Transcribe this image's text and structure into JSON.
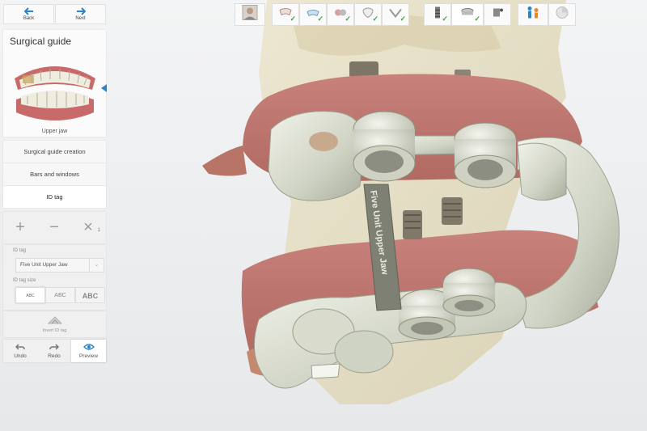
{
  "nav": {
    "back_label": "Back",
    "next_label": "Next"
  },
  "panel": {
    "title": "Surgical guide",
    "jaw_label": "Upper jaw",
    "steps": [
      {
        "label": "Surgical guide creation"
      },
      {
        "label": "Bars and windows"
      },
      {
        "label": "ID tag"
      }
    ],
    "tool_count": "1",
    "id_tag_label": "ID tag",
    "id_tag_value": "Five Unit Upper Jaw",
    "id_tag_size_label": "ID tag size",
    "sizes": [
      "ABC",
      "ABC",
      "ABC"
    ],
    "invert_label": "Invert ID tag",
    "undo_label": "Undo",
    "redo_label": "Redo",
    "preview_label": "Preview"
  },
  "scene": {
    "tag_text": "Five Unit Upper Jaw"
  },
  "workflow": {
    "steps": [
      {
        "icon": "patient-icon",
        "done": false
      },
      {
        "icon": "scan-icon",
        "done": true
      },
      {
        "icon": "scan-import-icon",
        "done": true
      },
      {
        "icon": "align-icon",
        "done": true
      },
      {
        "icon": "tooth-icon",
        "done": true
      },
      {
        "icon": "jaw-icon",
        "done": true
      },
      {
        "icon": "implant-icon",
        "done": true
      },
      {
        "icon": "guide-icon",
        "done": true
      },
      {
        "icon": "sleeve-icon",
        "done": false
      },
      {
        "icon": "people-icon",
        "done": false
      },
      {
        "icon": "export-icon",
        "done": false
      }
    ],
    "check": "✓"
  },
  "colors": {
    "accent": "#2b86c8",
    "check": "#43a047",
    "bone": "#e4dcbe",
    "guide": "#dcdfd2"
  }
}
